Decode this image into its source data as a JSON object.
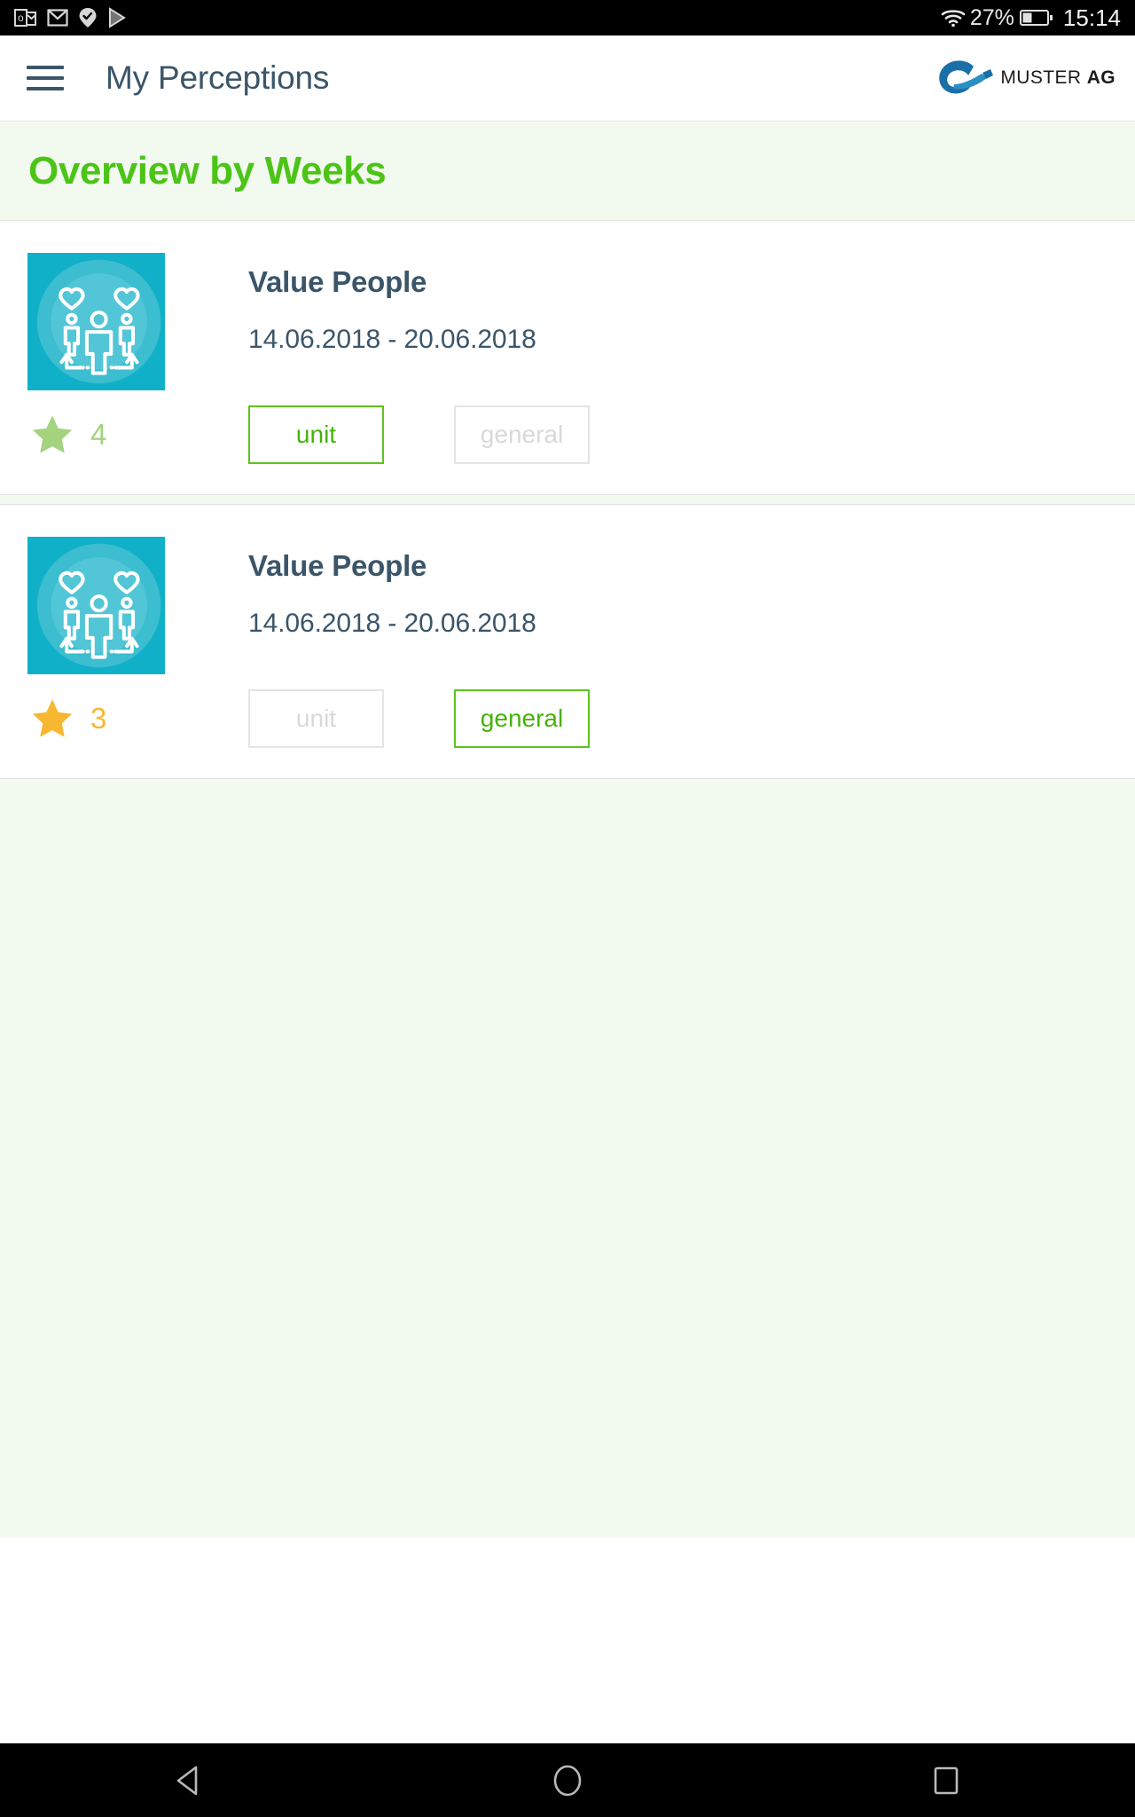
{
  "status_bar": {
    "icons": [
      "outlook-icon",
      "gmail-icon",
      "location-check-icon",
      "play-store-icon"
    ],
    "wifi_icon": "wifi-icon",
    "battery_percent": "27%",
    "battery_icon": "battery-icon",
    "time": "15:14"
  },
  "app_bar": {
    "menu_icon": "hamburger-menu-icon",
    "title": "My Perceptions",
    "brand": {
      "logo_icon": "muster-swoosh-logo",
      "name_light": "MUSTER ",
      "name_bold": "AG"
    }
  },
  "page": {
    "heading": "Overview by Weeks"
  },
  "colors": {
    "accent_green": "#4cc417",
    "button_green": "#46b308",
    "title_slate": "#3b5569",
    "tile_teal": "#10b0c8",
    "star_light_green": "#a4d27f",
    "star_amber": "#f7b731",
    "page_bg": "#f2faf0"
  },
  "cards": [
    {
      "icon_name": "value-people-icon",
      "title": "Value People",
      "date_range": "14.06.2018 - 20.06.2018",
      "rating": {
        "star_icon": "star-icon",
        "value": "4",
        "color": "#a4d27f"
      },
      "buttons": [
        {
          "label": "unit",
          "state": "active"
        },
        {
          "label": "general",
          "state": "inactive"
        }
      ]
    },
    {
      "icon_name": "value-people-icon",
      "title": "Value People",
      "date_range": "14.06.2018 - 20.06.2018",
      "rating": {
        "star_icon": "star-icon",
        "value": "3",
        "color": "#f7b731"
      },
      "buttons": [
        {
          "label": "unit",
          "state": "inactive"
        },
        {
          "label": "general",
          "state": "active"
        }
      ]
    }
  ],
  "nav_bar": {
    "back": "back-triangle-icon",
    "home": "home-circle-icon",
    "recents": "recents-square-icon"
  }
}
